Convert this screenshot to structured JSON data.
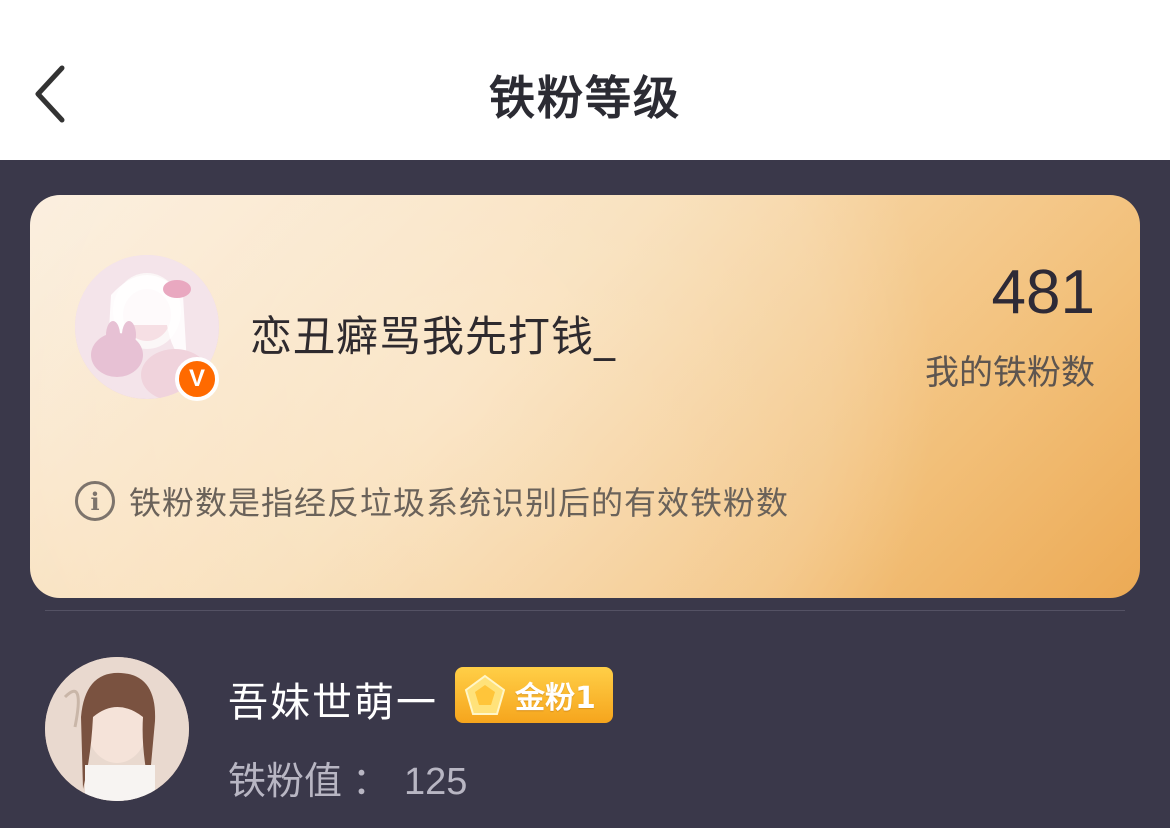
{
  "header": {
    "title": "铁粉等级",
    "back_icon": "chevron-left-icon"
  },
  "profile_card": {
    "username": "恋丑癖骂我先打钱_",
    "verified_badge": "V",
    "fan_count": "481",
    "fan_count_label": "我的铁粉数",
    "info_icon": "info-circle-icon",
    "info_text": "铁粉数是指经反垃圾系统识别后的有效铁粉数",
    "colors": {
      "card_start": "#fbeedd",
      "card_end": "#ecaa55",
      "badge": "#ff6a00"
    }
  },
  "fans": [
    {
      "name": "吾妹世萌一",
      "level_label": "金粉1",
      "level_icon": "gold-gem-icon",
      "value_label": "铁粉值",
      "value_sep": "：",
      "value": "125"
    }
  ],
  "colors": {
    "background": "#3a384a",
    "level_gold": "#f6a51d"
  }
}
